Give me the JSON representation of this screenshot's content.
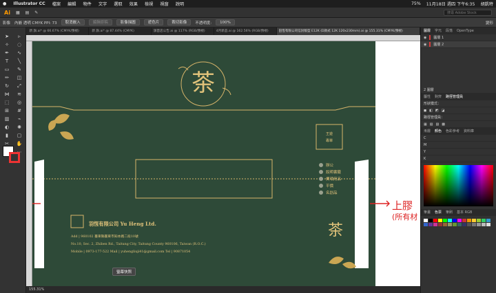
{
  "menubar": {
    "app": "Illustrator CC",
    "items": [
      "檔案",
      "編輯",
      "物件",
      "文字",
      "選取",
      "效果",
      "檢視",
      "視窗",
      "說明"
    ],
    "battery": "75%",
    "datetime": "11月18日 週四 下午6:35",
    "user": "胡凱特"
  },
  "appbar": {
    "logo": "Ai",
    "search_placeholder": "搜尋 Adobe Stock"
  },
  "control": {
    "label": "影像",
    "meta": "內嵌 透明 CMYK PPI: 73",
    "cancel_embed": "取消嵌入",
    "edit": "編輯原稿",
    "trace": "影像描圖",
    "mask": "遮色片",
    "crop": "裁切影像",
    "opacity_label": "不透明度:",
    "opacity_value": "100%",
    "transform": "變形"
  },
  "tabs": [
    " 新 旗.ai* @ 66.67% (CMYK/預視)",
    " 新 旗.ai* @ 87.44% (CMYK)",
    "旗首店公告.ai @ 117% (RGB/預視)",
    "4月新品.ai @ 162.56% (RGB/預視)",
    "田恆有限公司信封版型 E12K (D款式 12K 120x230mm).ai @ 155.31% (CMYK/預視)"
  ],
  "artwork": {
    "side_label": "王遊\n專單",
    "items": [
      "辦公",
      "說明書籤",
      "費項用品",
      "平價",
      "名創品"
    ],
    "company": "羽恆有限公司  Yu Heng Ltd.",
    "addr": "Add | 960102 臺東縣臺東市知本路二段10號",
    "addr_en": "No.10, Sec. 2, Zhiben Rd., Taitung City, Taitung County 960106, Taiwan (R.O.C.)",
    "contact": "Mobile | 0973-177-522   Mail | yuhengliuji41@gmail.com   Tel | 90871054",
    "seal_text": "茶"
  },
  "annotation": {
    "title": "上膠",
    "subtitle": "(所有材"
  },
  "tooltip": "螢幕快照",
  "status": {
    "zoom": "155.31%"
  },
  "panels": {
    "layer_tabs": [
      "圖層",
      "字元",
      "段落",
      "OpenType"
    ],
    "layers": [
      {
        "name": "圖層 1",
        "color": "#d93b3b"
      },
      {
        "name": "圖層 2",
        "color": "#d93b3b"
      }
    ],
    "layer_count": "2 圖層",
    "appearance_tabs": [
      "屬性",
      "對齊",
      "路徑管理員"
    ],
    "shape_mode": "形狀模式：",
    "pathfinder": "路徑管理員：",
    "color_tabs": [
      "漸層",
      "顏色",
      "色彩參考",
      "資料庫"
    ],
    "cmyk": [
      "C",
      "M",
      "Y",
      "K"
    ],
    "swatch_tabs": [
      "筆畫",
      "色票",
      "筆刷",
      "基本 RGB"
    ]
  }
}
